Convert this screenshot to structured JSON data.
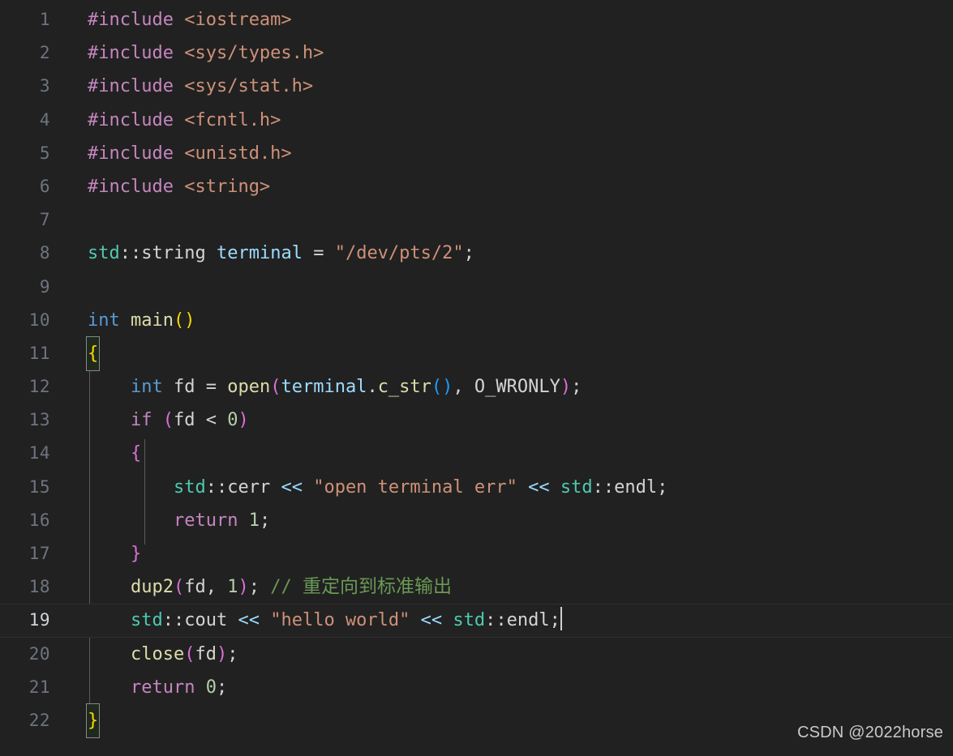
{
  "editor": {
    "language": "cpp",
    "background_color": "#212121",
    "active_line": 19,
    "total_lines": 22,
    "line_numbers": [
      "1",
      "2",
      "3",
      "4",
      "5",
      "6",
      "7",
      "8",
      "9",
      "10",
      "11",
      "12",
      "13",
      "14",
      "15",
      "16",
      "17",
      "18",
      "19",
      "20",
      "21",
      "22"
    ]
  },
  "code_lines": [
    {
      "n": "1",
      "text": "#include <iostream>"
    },
    {
      "n": "2",
      "text": "#include <sys/types.h>"
    },
    {
      "n": "3",
      "text": "#include <sys/stat.h>"
    },
    {
      "n": "4",
      "text": "#include <fcntl.h>"
    },
    {
      "n": "5",
      "text": "#include <unistd.h>"
    },
    {
      "n": "6",
      "text": "#include <string>"
    },
    {
      "n": "7",
      "text": ""
    },
    {
      "n": "8",
      "text": "std::string terminal = \"/dev/pts/2\";"
    },
    {
      "n": "9",
      "text": ""
    },
    {
      "n": "10",
      "text": "int main()"
    },
    {
      "n": "11",
      "text": "{"
    },
    {
      "n": "12",
      "text": "    int fd = open(terminal.c_str(), O_WRONLY);"
    },
    {
      "n": "13",
      "text": "    if (fd < 0)"
    },
    {
      "n": "14",
      "text": "    {"
    },
    {
      "n": "15",
      "text": "        std::cerr << \"open terminal err\" << std::endl;"
    },
    {
      "n": "16",
      "text": "        return 1;"
    },
    {
      "n": "17",
      "text": "    }"
    },
    {
      "n": "18",
      "text": "    dup2(fd, 1); // 重定向到标准输出"
    },
    {
      "n": "19",
      "text": "    std::cout << \"hello world\" << std::endl;"
    },
    {
      "n": "20",
      "text": "    close(fd);"
    },
    {
      "n": "21",
      "text": "    return 0;"
    },
    {
      "n": "22",
      "text": "}"
    }
  ],
  "tokens": {
    "include": "#include",
    "hdr_iostream": "<iostream>",
    "hdr_systypes": "<sys/types.h>",
    "hdr_sysstat": "<sys/stat.h>",
    "hdr_fcntl": "<fcntl.h>",
    "hdr_unistd": "<unistd.h>",
    "hdr_string": "<string>",
    "std": "std",
    "colons": "::",
    "string_t": "string",
    "var_terminal": "terminal",
    "eq": " = ",
    "str_devpts": "\"/dev/pts/2\"",
    "semi": ";",
    "int": "int",
    "main": "main",
    "paren_open": "(",
    "paren_close": ")",
    "brace_open": "{",
    "brace_close": "}",
    "var_fd": "fd",
    "fn_open": "open",
    "dot": ".",
    "fn_c_str": "c_str",
    "comma_space": ", ",
    "macro_wronly": "O_WRONLY",
    "kw_if": "if",
    "lt": " < ",
    "num_0": "0",
    "num_1": "1",
    "cerr": "cerr",
    "cout": "cout",
    "endl": "endl",
    "shift": "<<",
    "str_open_err": "\"open terminal err\"",
    "str_hello": "\"hello world\"",
    "kw_return": "return",
    "fn_dup2": "dup2",
    "fn_close": "close",
    "comment_slashes": "//",
    "comment_cjk": "重定向到标准输出",
    "space": " "
  },
  "colors": {
    "preprocessor": "#c586c0",
    "header": "#ce9178",
    "keyword": "#c586c0",
    "type": "#569cd6",
    "namespace": "#4ec9b0",
    "plain": "#d4d4d4",
    "variable": "#9cdcfe",
    "function": "#dcdcaa",
    "string": "#ce9178",
    "number": "#b5cea8",
    "comment": "#6a9955",
    "bracket_level1": "#ffd700",
    "bracket_level2": "#da70d6",
    "bracket_level3": "#179fff",
    "line_number": "#6e7480",
    "active_line_number": "#d0d4da"
  },
  "watermark": {
    "text": "CSDN @2022horse"
  }
}
